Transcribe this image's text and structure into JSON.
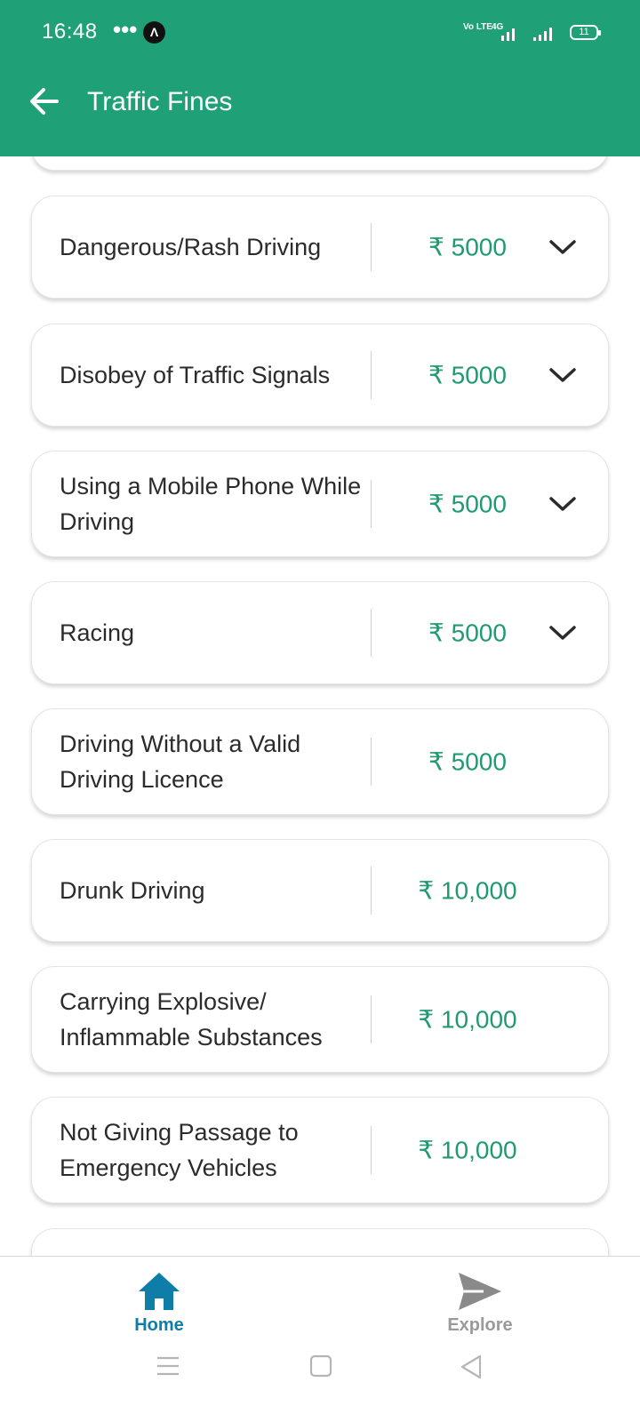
{
  "status_bar": {
    "time": "16:48",
    "dots": "•••",
    "app_badge": "Λ",
    "volte": "Vo LTE",
    "network": "4G",
    "battery": "11"
  },
  "app_bar": {
    "title": "Traffic Fines",
    "back_icon": "arrow-left-icon"
  },
  "fines": [
    {
      "name": "Dangerous/Rash Driving",
      "amount": "₹ 5000",
      "expandable": true
    },
    {
      "name": "Disobey of Traffic Signals",
      "amount": "₹ 5000",
      "expandable": true
    },
    {
      "name": "Using a Mobile Phone While Driving",
      "amount": "₹ 5000",
      "expandable": true
    },
    {
      "name": "Racing",
      "amount": "₹ 5000",
      "expandable": true
    },
    {
      "name": "Driving Without a Valid Driving Licence",
      "amount": "₹ 5000",
      "expandable": false
    },
    {
      "name": "Drunk Driving",
      "amount": "₹ 10,000",
      "expandable": false
    },
    {
      "name": "Carrying Explosive/ Inflammable Substances",
      "amount": "₹ 10,000",
      "expandable": false
    },
    {
      "name": "Not Giving Passage to Emergency Vehicles",
      "amount": "₹ 10,000",
      "expandable": false
    }
  ],
  "bottom_nav": {
    "items": [
      {
        "label": "Home",
        "icon": "home-icon",
        "active": true
      },
      {
        "label": "Explore",
        "icon": "send-icon",
        "active": false
      }
    ]
  },
  "colors": {
    "header": "#1fa077",
    "amount": "#1f9a72",
    "active_tab": "#0e7ea8",
    "inactive_tab": "#9a9a9a"
  }
}
